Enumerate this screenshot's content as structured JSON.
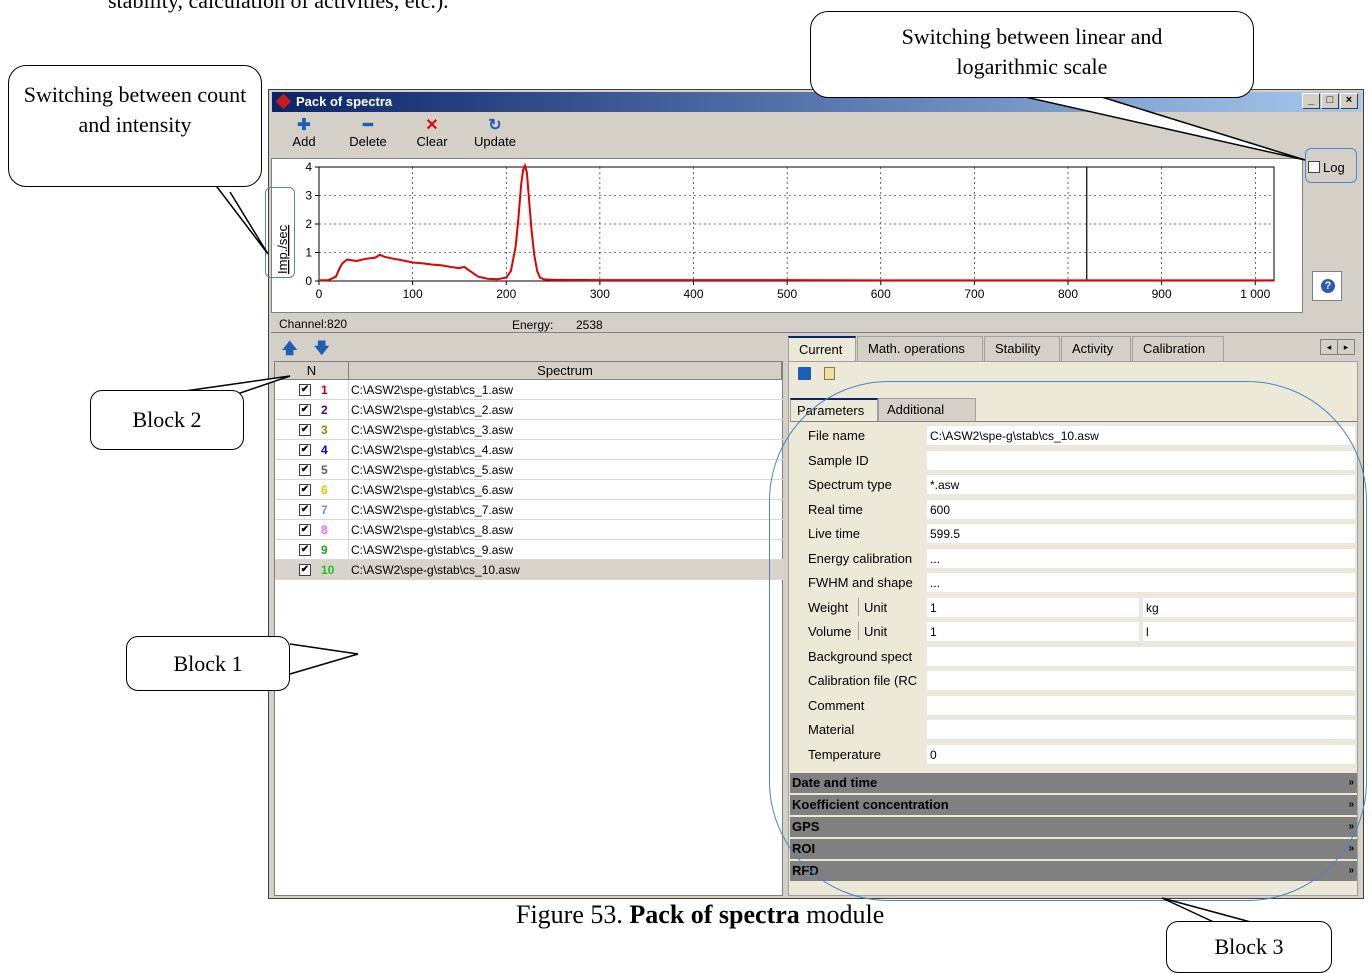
{
  "document": {
    "top_text": "stability, calculation of activities, etc.).",
    "caption_prefix": "Figure 53. ",
    "caption_bold": "Pack of spectra",
    "caption_suffix": " module"
  },
  "callouts": {
    "count_intensity": "Switching between count and intensity",
    "linear_log": "Switching between linear and logarithmic scale",
    "block1": "Block 1",
    "block2": "Block 2",
    "block3": "Block 3"
  },
  "window": {
    "title": "Pack of spectra",
    "controls": {
      "minimize": "_",
      "maximize": "□",
      "close": "×"
    }
  },
  "toolbar": [
    {
      "label": "Add",
      "icon": "plus-icon",
      "glyph": "✚",
      "color": "#1a5fb4"
    },
    {
      "label": "Delete",
      "icon": "minus-icon",
      "glyph": "━",
      "color": "#1a5fb4"
    },
    {
      "label": "Clear",
      "icon": "cross-icon",
      "glyph": "✕",
      "color": "#d01010"
    },
    {
      "label": "Update",
      "icon": "refresh-icon",
      "glyph": "↻",
      "color": "#1a5fb4"
    }
  ],
  "log_label": "Log",
  "status": {
    "channel": "Channel:820",
    "energy_label": "Energy:",
    "energy_value": "2538"
  },
  "chart_data": {
    "type": "line",
    "title": "",
    "xlabel": "",
    "ylabel": "Imp./sec",
    "xlim": [
      0,
      1020
    ],
    "ylim": [
      0,
      4
    ],
    "x_ticks": [
      "0",
      "100",
      "200",
      "300",
      "400",
      "500",
      "600",
      "700",
      "800",
      "900",
      "1 000"
    ],
    "x_tick_values": [
      0,
      100,
      200,
      300,
      400,
      500,
      600,
      700,
      800,
      900,
      1000
    ],
    "y_ticks": [
      "0",
      "1",
      "2",
      "3",
      "4"
    ],
    "y_tick_values": [
      0,
      1,
      2,
      3,
      4
    ],
    "grid": true,
    "cursor_channel": 820,
    "series": [
      {
        "color": "#e00000",
        "x": [
          0,
          10,
          18,
          22,
          25,
          30,
          40,
          50,
          60,
          65,
          70,
          80,
          90,
          100,
          110,
          120,
          130,
          140,
          150,
          155,
          160,
          170,
          180,
          190,
          200,
          205,
          210,
          213,
          216,
          218,
          220,
          222,
          224,
          227,
          230,
          233,
          236,
          240,
          245,
          250,
          260,
          300,
          400,
          500,
          600,
          700,
          800,
          900,
          1000,
          1020
        ],
        "y": [
          0.02,
          0.03,
          0.15,
          0.45,
          0.62,
          0.75,
          0.7,
          0.78,
          0.82,
          0.92,
          0.85,
          0.78,
          0.72,
          0.65,
          0.62,
          0.58,
          0.55,
          0.5,
          0.45,
          0.5,
          0.38,
          0.15,
          0.08,
          0.06,
          0.12,
          0.35,
          1.2,
          2.2,
          3.4,
          3.9,
          4.05,
          3.8,
          3.0,
          1.8,
          0.9,
          0.35,
          0.12,
          0.06,
          0.05,
          0.04,
          0.04,
          0.03,
          0.03,
          0.03,
          0.02,
          0.02,
          0.02,
          0.02,
          0.02,
          0.02
        ]
      }
    ]
  },
  "list": {
    "header_n": "N",
    "header_spectrum": "Spectrum",
    "rows": [
      {
        "n": "1",
        "color": "#c00000",
        "path": "C:\\ASW2\\spe-g\\stab\\cs_1.asw",
        "check": "✔"
      },
      {
        "n": "2",
        "color": "#600080",
        "path": "C:\\ASW2\\spe-g\\stab\\cs_2.asw",
        "check": "✔"
      },
      {
        "n": "3",
        "color": "#a08000",
        "path": "C:\\ASW2\\spe-g\\stab\\cs_3.asw",
        "check": "✔"
      },
      {
        "n": "4",
        "color": "#0000e0",
        "path": "C:\\ASW2\\spe-g\\stab\\cs_4.asw",
        "check": "✔"
      },
      {
        "n": "5",
        "color": "#606060",
        "path": "C:\\ASW2\\spe-g\\stab\\cs_5.asw",
        "check": "✔"
      },
      {
        "n": "6",
        "color": "#f0c000",
        "path": "C:\\ASW2\\spe-g\\stab\\cs_6.asw",
        "check": "✔"
      },
      {
        "n": "7",
        "color": "#8080ff",
        "path": "C:\\ASW2\\spe-g\\stab\\cs_7.asw",
        "check": "✔"
      },
      {
        "n": "8",
        "color": "#ff60ff",
        "path": "C:\\ASW2\\spe-g\\stab\\cs_8.asw",
        "check": "✔"
      },
      {
        "n": "9",
        "color": "#20a020",
        "path": "C:\\ASW2\\spe-g\\stab\\cs_9.asw",
        "check": "✔"
      },
      {
        "n": "10",
        "color": "#20c020",
        "path": "C:\\ASW2\\spe-g\\stab\\cs_10.asw",
        "check": "✔"
      }
    ]
  },
  "tabs": [
    "Current",
    "Math. operations",
    "Stability",
    "Activity",
    "Calibration"
  ],
  "subtabs": [
    "Parameters",
    "Additional"
  ],
  "fields": [
    {
      "label": "File name",
      "value": "C:\\ASW2\\spe-g\\stab\\cs_10.asw"
    },
    {
      "label": "Sample ID",
      "value": ""
    },
    {
      "label": "Spectrum type",
      "value": "*.asw"
    },
    {
      "label": "Real time",
      "value": "600"
    },
    {
      "label": "Live time",
      "value": "599.5"
    },
    {
      "label": "Energy calibration",
      "value": "..."
    },
    {
      "label": "FWHM and shape",
      "value": "..."
    }
  ],
  "weight": {
    "label": "Weight",
    "unit_label": "Unit",
    "value": "1",
    "unit": "kg"
  },
  "volume": {
    "label": "Volume",
    "unit_label": "Unit",
    "value": "1",
    "unit": "l"
  },
  "fields2": [
    {
      "label": "Background spect",
      "value": ""
    },
    {
      "label": "Calibration file (RC",
      "value": ""
    },
    {
      "label": "Comment",
      "value": ""
    },
    {
      "label": "Material",
      "value": ""
    },
    {
      "label": "Temperature",
      "value": "0"
    }
  ],
  "groups": [
    "Date and time",
    "Koefficient concentration",
    "GPS",
    "ROI",
    "RFD"
  ],
  "group_chevron": "»",
  "scroll_arrows": {
    "left": "◂",
    "right": "▸"
  },
  "move_arrows": {
    "up": "🡅",
    "down": "🡇"
  }
}
